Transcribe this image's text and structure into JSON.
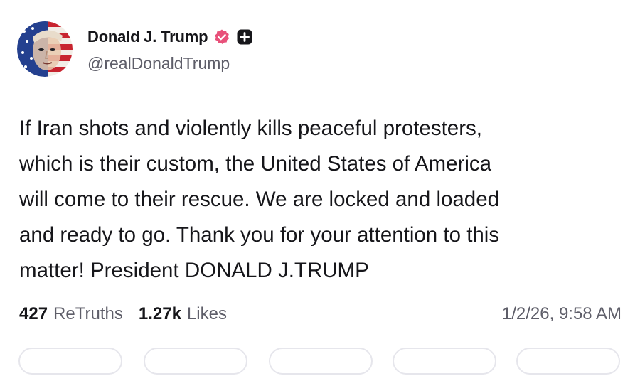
{
  "post": {
    "author": {
      "display_name": "Donald J. Trump",
      "handle": "@realDonaldTrump",
      "verified_badge_icon": "verified-badge-icon",
      "verified_badge_color": "#e8517a",
      "follow_icon": "plus-icon"
    },
    "text": "If Iran shots and violently kills peaceful protesters,\nwhich is their custom, the United States of America\nwill come to their rescue. We are locked and loaded\nand ready to go. Thank you for your attention to this\nmatter! President DONALD J.TRUMP",
    "stats": {
      "retruths_count": "427",
      "retruths_label": "ReTruths",
      "likes_count": "1.27k",
      "likes_label": "Likes"
    },
    "timestamp": "1/2/26, 9:58 AM"
  },
  "colors": {
    "text_primary": "#16161a",
    "text_secondary": "#5e5e69",
    "button_border": "#e6e6ec"
  }
}
